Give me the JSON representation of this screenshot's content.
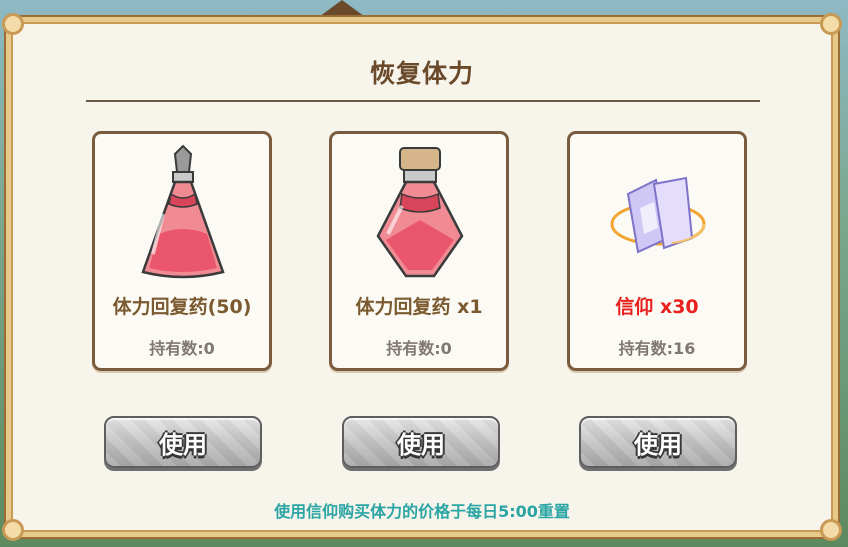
{
  "dialog": {
    "title": "恢复体力",
    "footnote": "使用信仰购买体力的价格于每日5:00重置"
  },
  "items": [
    {
      "name": "体力回复药(50)",
      "owned": "持有数:0",
      "icon": "small-stamina-potion-icon",
      "button": "使用"
    },
    {
      "name": "体力回复药 x1",
      "owned": "持有数:0",
      "icon": "large-stamina-potion-icon",
      "button": "使用"
    },
    {
      "name": "信仰 x30",
      "owned": "持有数:16",
      "icon": "faith-crystal-icon",
      "button": "使用"
    }
  ],
  "colors": {
    "title": "#6b4a2b",
    "item_name": "#7a5a2e",
    "faith_name": "#e8211f",
    "footnote": "#2aa5a4",
    "panel_border": "#c99a55"
  }
}
